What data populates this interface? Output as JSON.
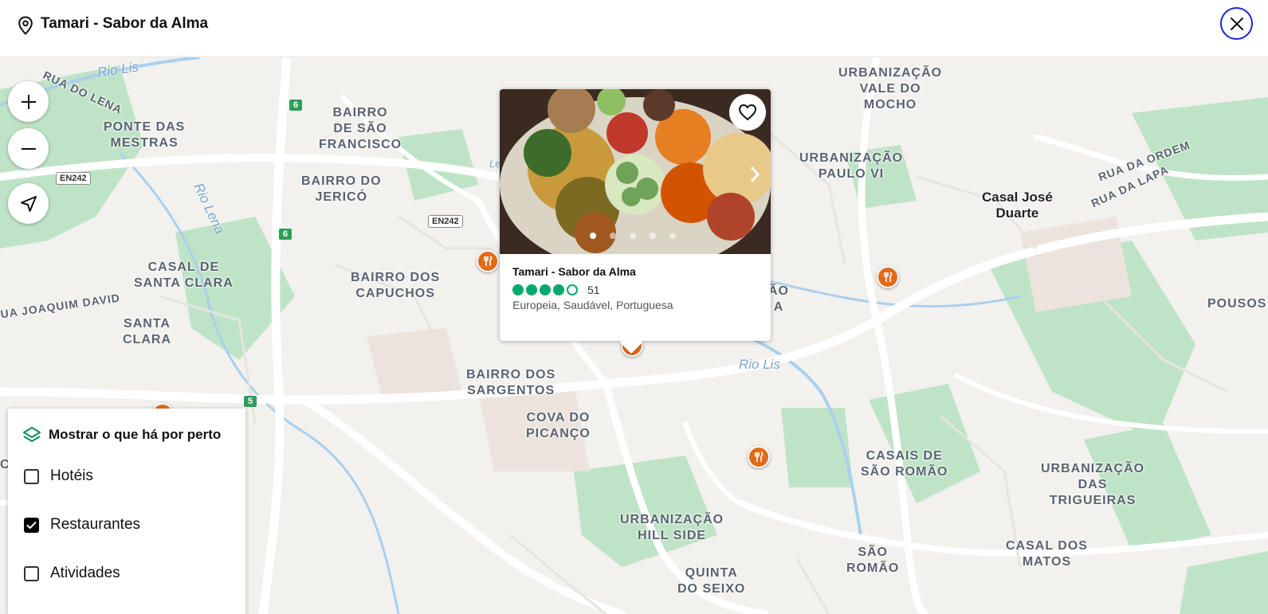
{
  "header": {
    "title": "Tamari - Sabor da Alma",
    "icons": {
      "location": "map-pin-icon",
      "close": "close-icon"
    }
  },
  "map": {
    "areas": [
      {
        "id": "ponte",
        "lines": [
          "PONTE DAS",
          "MESTRAS"
        ]
      },
      {
        "id": "saofrancisco",
        "lines": [
          "BAIRRO",
          "DE SÃO",
          "FRANCISCO"
        ]
      },
      {
        "id": "jerico",
        "lines": [
          "BAIRRO DO",
          "JERICÓ"
        ]
      },
      {
        "id": "capuchos",
        "lines": [
          "BAIRRO DOS",
          "CAPUCHOS"
        ]
      },
      {
        "id": "casalclara",
        "lines": [
          "CASAL DE",
          "SANTA CLARA"
        ]
      },
      {
        "id": "santaclara",
        "lines": [
          "SANTA",
          "CLARA"
        ]
      },
      {
        "id": "sargentos",
        "lines": [
          "BAIRRO DOS",
          "SARGENTOS"
        ]
      },
      {
        "id": "picanco",
        "lines": [
          "COVA DO",
          "PICANÇO"
        ]
      },
      {
        "id": "hillside",
        "lines": [
          "URBANIZAÇÃO",
          "HILL SIDE"
        ]
      },
      {
        "id": "seixo",
        "lines": [
          "QUINTA",
          "DO SEIXO"
        ]
      },
      {
        "id": "mocho",
        "lines": [
          "URBANIZAÇÃO",
          "VALE DO",
          "MOCHO"
        ]
      },
      {
        "id": "pauloVI",
        "lines": [
          "URBANIZAÇÃO",
          "PAULO VI"
        ]
      },
      {
        "id": "saoromao",
        "lines": [
          "CASAIS DE",
          "SÃO ROMÃO"
        ]
      },
      {
        "id": "romao",
        "lines": [
          "SÃO",
          "ROMÃO"
        ]
      },
      {
        "id": "trigueiras",
        "lines": [
          "URBANIZAÇÃO",
          "DAS",
          "TRIGUEIRAS"
        ]
      },
      {
        "id": "matos",
        "lines": [
          "CASAL DOS",
          "MATOS"
        ]
      },
      {
        "id": "pousos",
        "lines": [
          "POUSOS"
        ]
      },
      {
        "id": "ao",
        "lines": [
          "ÃO",
          "A"
        ]
      }
    ],
    "streets": [
      "RUA DO LENA",
      "UA JOAQUIM DAVID",
      "RUA DA ORDEM",
      "RUA DA LAPA"
    ],
    "water": [
      "Rio Lis",
      "Rio Lena",
      "Rio Lis"
    ],
    "poi": [
      "Casal José",
      "Duarte"
    ],
    "road_shields": [
      "6",
      "6",
      "5"
    ],
    "euro_shields": [
      "EN242",
      "EN242"
    ],
    "restaurant_pins": 5,
    "map_icons": [
      "restaurant-icon"
    ],
    "partial_text": [
      "Le",
      "C"
    ]
  },
  "controls": {
    "icons": [
      "zoom-in-icon",
      "zoom-out-icon",
      "locate-me-icon"
    ]
  },
  "popup": {
    "name": "Tamari - Sabor da Alma",
    "rating": 4,
    "rating_max": 5,
    "review_count": "51",
    "cuisine": "Europeia, Saudável, Portuguesa",
    "photo_count": 5,
    "active_photo": 0,
    "icons": {
      "save": "heart-icon",
      "next": "chevron-right-icon"
    },
    "colors": {
      "bubble": "#00aa6c"
    }
  },
  "nearby": {
    "title": "Mostrar o que há por perto",
    "icon": "layers-icon",
    "options": [
      {
        "label": "Hotéis",
        "checked": false
      },
      {
        "label": "Restaurantes",
        "checked": true
      },
      {
        "label": "Atividades",
        "checked": false
      }
    ]
  },
  "colors": {
    "accent_close": "#1a2ad0",
    "pin": "#e26b1a",
    "park": "#bfe3c6",
    "road": "#ffffff",
    "river": "#a9d0ee"
  }
}
